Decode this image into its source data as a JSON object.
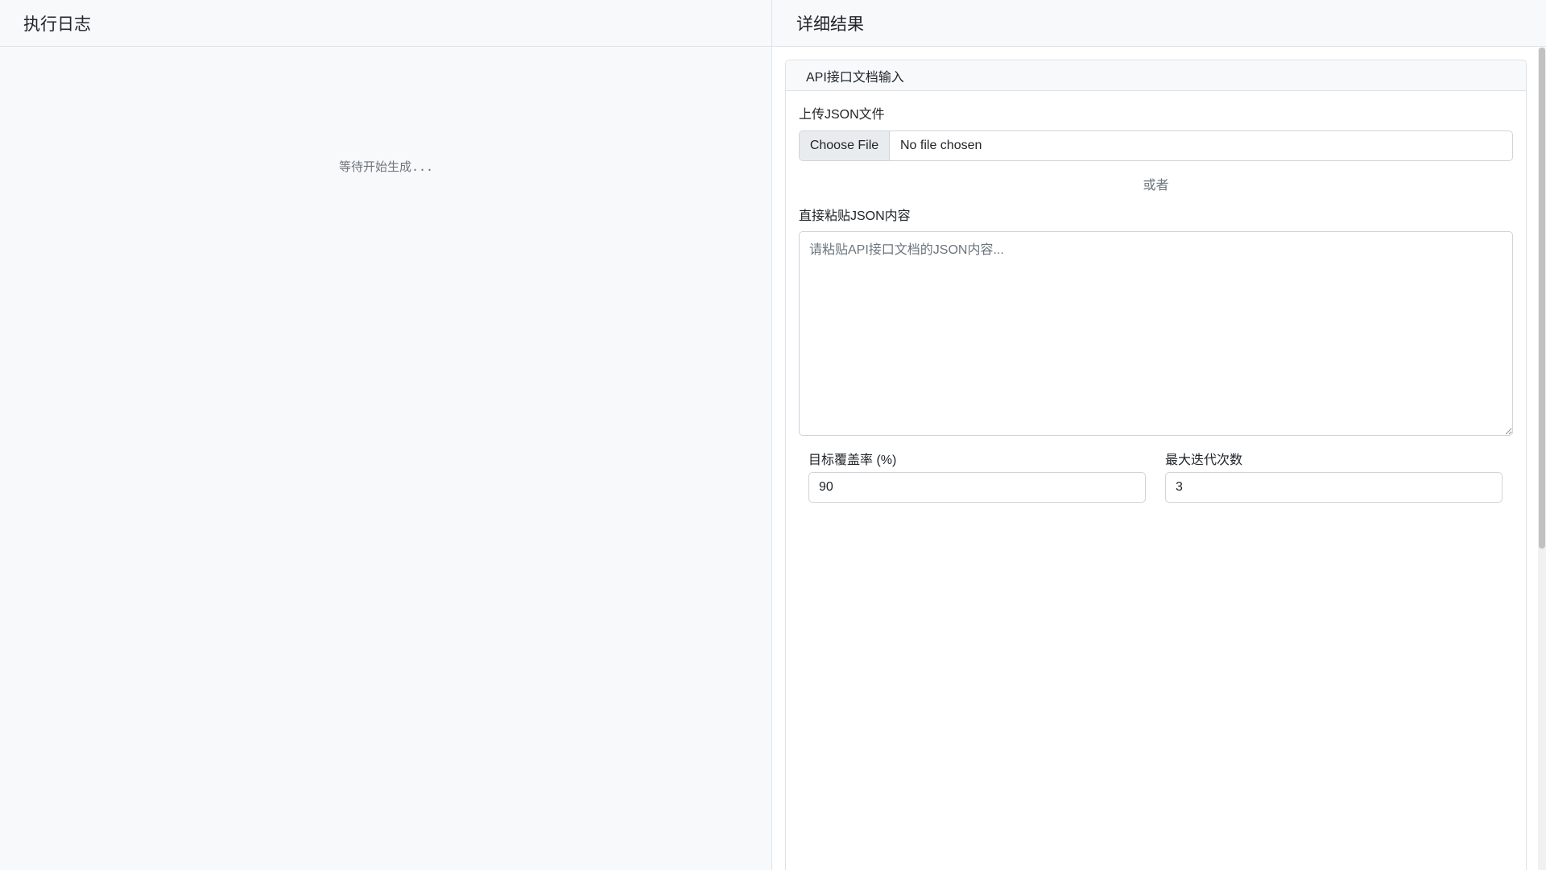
{
  "log_panel": {
    "title": "执行日志",
    "waiting_text": "等待开始生成..."
  },
  "result_panel": {
    "title": "详细结果",
    "card": {
      "header": "API接口文档输入",
      "upload_label": "上传JSON文件",
      "file_button": "Choose File",
      "file_status": "No file chosen",
      "or_text": "或者",
      "paste_label": "直接粘贴JSON内容",
      "paste_placeholder": "请粘贴API接口文档的JSON内容...",
      "coverage_label": "目标覆盖率 (%)",
      "coverage_value": "90",
      "iterations_label": "最大迭代次数",
      "iterations_value": "3"
    }
  }
}
